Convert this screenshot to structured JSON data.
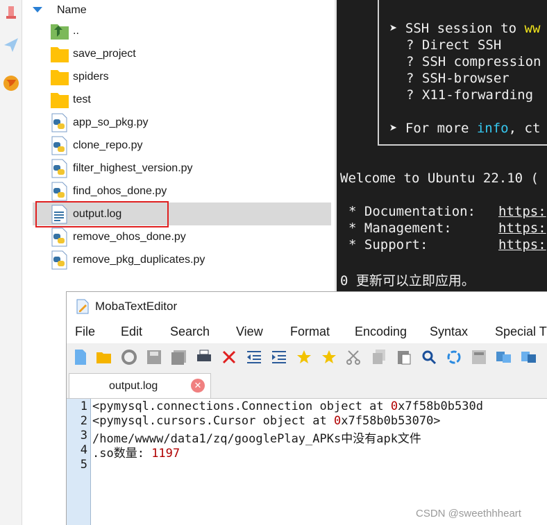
{
  "file_browser": {
    "header_label": "Name",
    "files": [
      {
        "name": "..",
        "icon": "parent-folder-icon"
      },
      {
        "name": "save_project",
        "icon": "folder-icon"
      },
      {
        "name": "spiders",
        "icon": "folder-icon"
      },
      {
        "name": "test",
        "icon": "folder-icon"
      },
      {
        "name": "app_so_pkg.py",
        "icon": "python-file-icon"
      },
      {
        "name": "clone_repo.py",
        "icon": "python-file-icon"
      },
      {
        "name": "filter_highest_version.py",
        "icon": "python-file-icon"
      },
      {
        "name": "find_ohos_done.py",
        "icon": "python-file-icon"
      },
      {
        "name": "output.log",
        "icon": "text-file-icon",
        "selected": true
      },
      {
        "name": "remove_ohos_done.py",
        "icon": "python-file-icon"
      },
      {
        "name": "remove_pkg_duplicates.py",
        "icon": "python-file-icon"
      }
    ]
  },
  "terminal": {
    "lines": [
      {
        "bullet": "➤",
        "text": "SSH session to ",
        "highlight": "ww"
      },
      {
        "bullet": "?",
        "text": "Direct SSH"
      },
      {
        "bullet": "?",
        "text": "SSH compression"
      },
      {
        "bullet": "?",
        "text": "SSH-browser"
      },
      {
        "bullet": "?",
        "text": "X11-forwarding"
      },
      {
        "bullet": "➤",
        "text": "For more ",
        "highlight": "info",
        "tail": ", ct"
      },
      {
        "text": "Welcome to Ubuntu 22.10 ("
      },
      {
        "bullet": "*",
        "label": "Documentation:",
        "link": "https:"
      },
      {
        "bullet": "*",
        "label": "Management:",
        "link": "https:"
      },
      {
        "bullet": "*",
        "label": "Support:",
        "link": "https:"
      },
      {
        "text": "0 更新可以立即应用。"
      }
    ]
  },
  "editor": {
    "title": "MobaTextEditor",
    "menu": [
      "File",
      "Edit",
      "Search",
      "View",
      "Format",
      "Encoding",
      "Syntax",
      "Special T"
    ],
    "toolbar_icons": [
      "new-file-icon",
      "open-folder-icon",
      "reload-icon",
      "save-icon",
      "save-all-icon",
      "print-icon",
      "close-icon",
      "indent-decrease-icon",
      "indent-increase-icon",
      "bookmark-toggle-icon",
      "bookmark-next-icon",
      "cut-icon",
      "copy-icon",
      "paste-icon",
      "search-icon",
      "replace-icon",
      "calculator-icon",
      "compare-left-icon",
      "compare-right-icon"
    ],
    "tab_label": "output.log",
    "lines": [
      {
        "n": "1",
        "text": "<pymysql.connections.Connection object at ",
        "num": "0",
        "tail": "x7f58b0b530d"
      },
      {
        "n": "2",
        "text": "<pymysql.cursors.Cursor object at ",
        "num": "0",
        "tail": "x7f58b0b53070>"
      },
      {
        "n": "3",
        "text": "/home/wwww/data1/zq/googlePlay_APKs中没有apk文件"
      },
      {
        "n": "4",
        "text": ".so数量: ",
        "num": "1197"
      },
      {
        "n": "5",
        "text": ""
      }
    ]
  },
  "watermark": "CSDN @sweethhheart",
  "colors": {
    "selection": "#d9d9d9",
    "highlight_box": "#e02020",
    "terminal_bg": "#1e1e1e",
    "gutter": "#d9e8f7"
  }
}
